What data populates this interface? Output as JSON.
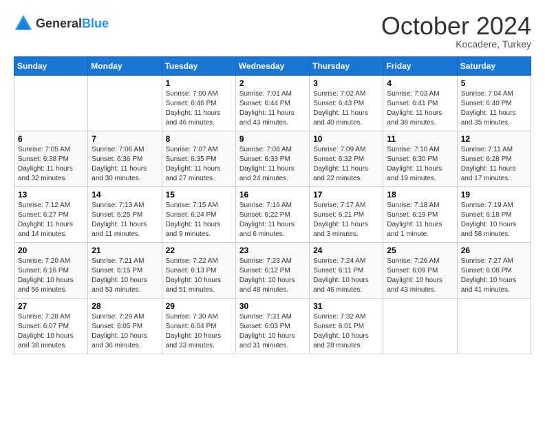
{
  "header": {
    "logo": {
      "general": "General",
      "blue": "Blue"
    },
    "title": "October 2024",
    "location": "Kocadere, Turkey"
  },
  "days_of_week": [
    "Sunday",
    "Monday",
    "Tuesday",
    "Wednesday",
    "Thursday",
    "Friday",
    "Saturday"
  ],
  "weeks": [
    [
      {
        "day": "",
        "sunrise": "",
        "sunset": "",
        "daylight": ""
      },
      {
        "day": "",
        "sunrise": "",
        "sunset": "",
        "daylight": ""
      },
      {
        "day": "1",
        "sunrise": "Sunrise: 7:00 AM",
        "sunset": "Sunset: 6:46 PM",
        "daylight": "Daylight: 11 hours and 46 minutes."
      },
      {
        "day": "2",
        "sunrise": "Sunrise: 7:01 AM",
        "sunset": "Sunset: 6:44 PM",
        "daylight": "Daylight: 11 hours and 43 minutes."
      },
      {
        "day": "3",
        "sunrise": "Sunrise: 7:02 AM",
        "sunset": "Sunset: 6:43 PM",
        "daylight": "Daylight: 11 hours and 40 minutes."
      },
      {
        "day": "4",
        "sunrise": "Sunrise: 7:03 AM",
        "sunset": "Sunset: 6:41 PM",
        "daylight": "Daylight: 11 hours and 38 minutes."
      },
      {
        "day": "5",
        "sunrise": "Sunrise: 7:04 AM",
        "sunset": "Sunset: 6:40 PM",
        "daylight": "Daylight: 11 hours and 35 minutes."
      }
    ],
    [
      {
        "day": "6",
        "sunrise": "Sunrise: 7:05 AM",
        "sunset": "Sunset: 6:38 PM",
        "daylight": "Daylight: 11 hours and 32 minutes."
      },
      {
        "day": "7",
        "sunrise": "Sunrise: 7:06 AM",
        "sunset": "Sunset: 6:36 PM",
        "daylight": "Daylight: 11 hours and 30 minutes."
      },
      {
        "day": "8",
        "sunrise": "Sunrise: 7:07 AM",
        "sunset": "Sunset: 6:35 PM",
        "daylight": "Daylight: 11 hours and 27 minutes."
      },
      {
        "day": "9",
        "sunrise": "Sunrise: 7:08 AM",
        "sunset": "Sunset: 6:33 PM",
        "daylight": "Daylight: 11 hours and 24 minutes."
      },
      {
        "day": "10",
        "sunrise": "Sunrise: 7:09 AM",
        "sunset": "Sunset: 6:32 PM",
        "daylight": "Daylight: 11 hours and 22 minutes."
      },
      {
        "day": "11",
        "sunrise": "Sunrise: 7:10 AM",
        "sunset": "Sunset: 6:30 PM",
        "daylight": "Daylight: 11 hours and 19 minutes."
      },
      {
        "day": "12",
        "sunrise": "Sunrise: 7:11 AM",
        "sunset": "Sunset: 6:28 PM",
        "daylight": "Daylight: 11 hours and 17 minutes."
      }
    ],
    [
      {
        "day": "13",
        "sunrise": "Sunrise: 7:12 AM",
        "sunset": "Sunset: 6:27 PM",
        "daylight": "Daylight: 11 hours and 14 minutes."
      },
      {
        "day": "14",
        "sunrise": "Sunrise: 7:13 AM",
        "sunset": "Sunset: 6:25 PM",
        "daylight": "Daylight: 11 hours and 11 minutes."
      },
      {
        "day": "15",
        "sunrise": "Sunrise: 7:15 AM",
        "sunset": "Sunset: 6:24 PM",
        "daylight": "Daylight: 11 hours and 9 minutes."
      },
      {
        "day": "16",
        "sunrise": "Sunrise: 7:16 AM",
        "sunset": "Sunset: 6:22 PM",
        "daylight": "Daylight: 11 hours and 6 minutes."
      },
      {
        "day": "17",
        "sunrise": "Sunrise: 7:17 AM",
        "sunset": "Sunset: 6:21 PM",
        "daylight": "Daylight: 11 hours and 3 minutes."
      },
      {
        "day": "18",
        "sunrise": "Sunrise: 7:18 AM",
        "sunset": "Sunset: 6:19 PM",
        "daylight": "Daylight: 11 hours and 1 minute."
      },
      {
        "day": "19",
        "sunrise": "Sunrise: 7:19 AM",
        "sunset": "Sunset: 6:18 PM",
        "daylight": "Daylight: 10 hours and 58 minutes."
      }
    ],
    [
      {
        "day": "20",
        "sunrise": "Sunrise: 7:20 AM",
        "sunset": "Sunset: 6:16 PM",
        "daylight": "Daylight: 10 hours and 56 minutes."
      },
      {
        "day": "21",
        "sunrise": "Sunrise: 7:21 AM",
        "sunset": "Sunset: 6:15 PM",
        "daylight": "Daylight: 10 hours and 53 minutes."
      },
      {
        "day": "22",
        "sunrise": "Sunrise: 7:22 AM",
        "sunset": "Sunset: 6:13 PM",
        "daylight": "Daylight: 10 hours and 51 minutes."
      },
      {
        "day": "23",
        "sunrise": "Sunrise: 7:23 AM",
        "sunset": "Sunset: 6:12 PM",
        "daylight": "Daylight: 10 hours and 48 minutes."
      },
      {
        "day": "24",
        "sunrise": "Sunrise: 7:24 AM",
        "sunset": "Sunset: 6:11 PM",
        "daylight": "Daylight: 10 hours and 46 minutes."
      },
      {
        "day": "25",
        "sunrise": "Sunrise: 7:26 AM",
        "sunset": "Sunset: 6:09 PM",
        "daylight": "Daylight: 10 hours and 43 minutes."
      },
      {
        "day": "26",
        "sunrise": "Sunrise: 7:27 AM",
        "sunset": "Sunset: 6:08 PM",
        "daylight": "Daylight: 10 hours and 41 minutes."
      }
    ],
    [
      {
        "day": "27",
        "sunrise": "Sunrise: 7:28 AM",
        "sunset": "Sunset: 6:07 PM",
        "daylight": "Daylight: 10 hours and 38 minutes."
      },
      {
        "day": "28",
        "sunrise": "Sunrise: 7:29 AM",
        "sunset": "Sunset: 6:05 PM",
        "daylight": "Daylight: 10 hours and 36 minutes."
      },
      {
        "day": "29",
        "sunrise": "Sunrise: 7:30 AM",
        "sunset": "Sunset: 6:04 PM",
        "daylight": "Daylight: 10 hours and 33 minutes."
      },
      {
        "day": "30",
        "sunrise": "Sunrise: 7:31 AM",
        "sunset": "Sunset: 6:03 PM",
        "daylight": "Daylight: 10 hours and 31 minutes."
      },
      {
        "day": "31",
        "sunrise": "Sunrise: 7:32 AM",
        "sunset": "Sunset: 6:01 PM",
        "daylight": "Daylight: 10 hours and 28 minutes."
      },
      {
        "day": "",
        "sunrise": "",
        "sunset": "",
        "daylight": ""
      },
      {
        "day": "",
        "sunrise": "",
        "sunset": "",
        "daylight": ""
      }
    ]
  ]
}
